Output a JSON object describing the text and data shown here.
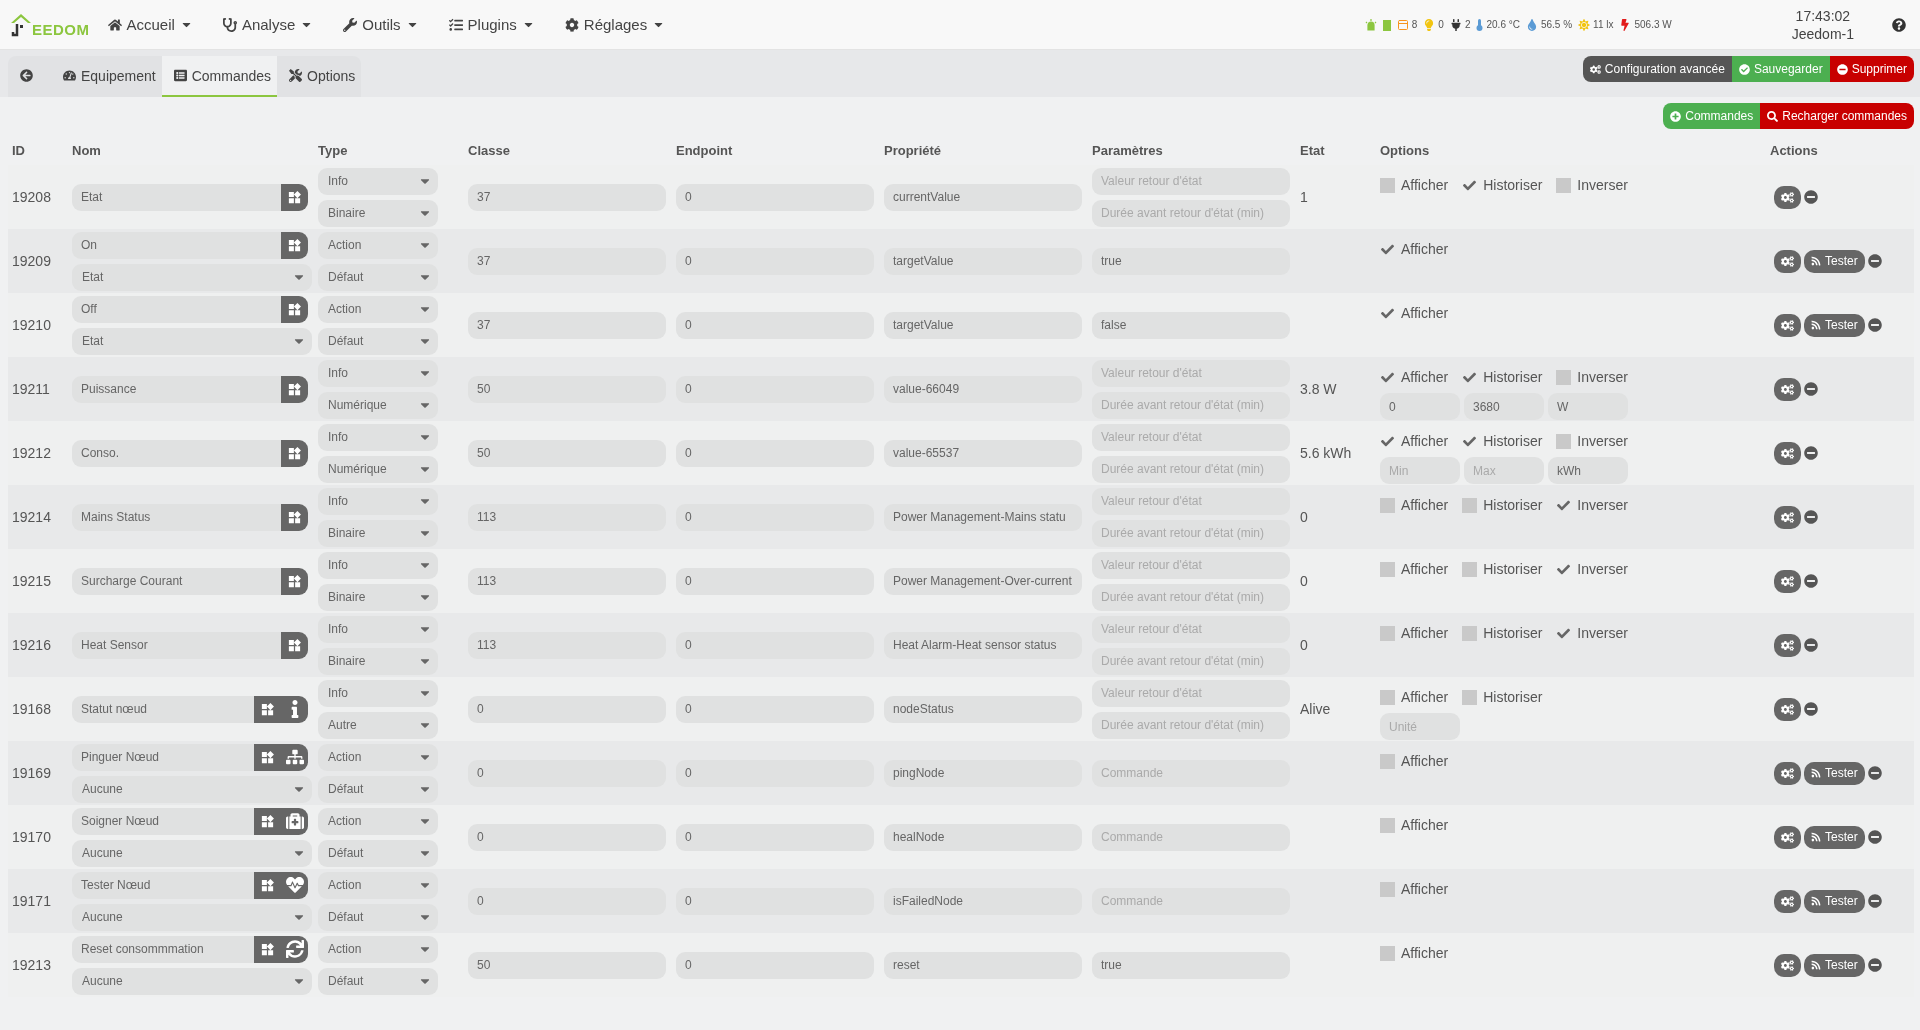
{
  "navbar": {
    "logo": "EEDOM",
    "menus": [
      {
        "kind": "home",
        "label": "Accueil"
      },
      {
        "kind": "stethoscope",
        "label": "Analyse"
      },
      {
        "kind": "wrench",
        "label": "Outils"
      },
      {
        "kind": "tasks",
        "label": "Plugins"
      },
      {
        "kind": "cog",
        "label": "Réglages"
      }
    ],
    "status": [
      {
        "kind": "siren",
        "color": "#8cc63f"
      },
      {
        "kind": "battery",
        "color": "#8cc63f"
      },
      {
        "kind": "window",
        "color": "#f7941d",
        "text": "8"
      },
      {
        "kind": "bulb",
        "color": "#f2c511",
        "text": "0"
      },
      {
        "kind": "plug",
        "color": "#333333",
        "text": "2"
      },
      {
        "kind": "thermometer",
        "color": "#5b9bd5",
        "text": "20.6 °C"
      },
      {
        "kind": "drop",
        "color": "#5b9bd5",
        "text": "56.5 %"
      },
      {
        "kind": "sun",
        "color": "#f2c511",
        "text": "11 lx"
      },
      {
        "kind": "bolt",
        "color": "#e21b1b",
        "text": "506.3 W"
      }
    ],
    "clock": "17:43:02",
    "host": "Jeedom-1"
  },
  "tabs": [
    {
      "kind": "back",
      "selected": false
    },
    {
      "kind": "gauge",
      "label": "Equipement",
      "selected": false
    },
    {
      "kind": "list",
      "label": "Commandes",
      "selected": true
    },
    {
      "kind": "tools",
      "label": "Options",
      "selected": false
    }
  ],
  "top_buttons": [
    {
      "kind": "advanced",
      "label": "Configuration avancée"
    },
    {
      "kind": "save",
      "label": "Sauvegarder"
    },
    {
      "kind": "delete",
      "label": "Supprimer"
    }
  ],
  "command_buttons": [
    {
      "kind": "add",
      "label": "Commandes"
    },
    {
      "kind": "reload",
      "label": "Recharger commandes"
    }
  ],
  "table": {
    "columns": [
      "ID",
      "Nom",
      "Type",
      "Classe",
      "Endpoint",
      "Propriété",
      "Paramètres",
      "Etat",
      "Options",
      "Actions"
    ],
    "rows": [
      {
        "id": "19208",
        "name": "Etat",
        "name_buttons": [
          {
            "kind": "widget"
          }
        ],
        "type": "Info",
        "subtype": "Binaire",
        "classe": "37",
        "endpoint": "0",
        "propriete": "currentValue",
        "params": [
          {
            "placeholder": "Valeur retour d'état"
          },
          {
            "placeholder": "Durée avant retour d'état (min)"
          }
        ],
        "etat": "1",
        "options": [
          {
            "label": "Afficher",
            "checked": false
          },
          {
            "label": "Historiser",
            "checked": true
          },
          {
            "label": "Inverser",
            "checked": false
          }
        ],
        "actions": [
          {
            "kind": "settings"
          },
          {
            "kind": "remove"
          }
        ]
      },
      {
        "id": "19209",
        "name": "On",
        "name_buttons": [
          {
            "kind": "widget"
          }
        ],
        "value_select": "Etat",
        "type": "Action",
        "subtype": "Défaut",
        "classe": "37",
        "endpoint": "0",
        "propriete": "targetValue",
        "params": [
          {
            "value": "true"
          }
        ],
        "options": [
          {
            "label": "Afficher",
            "checked": true
          }
        ],
        "actions": [
          {
            "kind": "settings"
          },
          {
            "kind": "test",
            "label": "Tester"
          },
          {
            "kind": "remove"
          }
        ]
      },
      {
        "id": "19210",
        "name": "Off",
        "name_buttons": [
          {
            "kind": "widget"
          }
        ],
        "value_select": "Etat",
        "type": "Action",
        "subtype": "Défaut",
        "classe": "37",
        "endpoint": "0",
        "propriete": "targetValue",
        "params": [
          {
            "value": "false"
          }
        ],
        "options": [
          {
            "label": "Afficher",
            "checked": true
          }
        ],
        "actions": [
          {
            "kind": "settings"
          },
          {
            "kind": "test",
            "label": "Tester"
          },
          {
            "kind": "remove"
          }
        ]
      },
      {
        "id": "19211",
        "name": "Puissance",
        "name_buttons": [
          {
            "kind": "widget"
          }
        ],
        "type": "Info",
        "subtype": "Numérique",
        "classe": "50",
        "endpoint": "0",
        "propriete": "value-66049",
        "params": [
          {
            "placeholder": "Valeur retour d'état"
          },
          {
            "placeholder": "Durée avant retour d'état (min)"
          }
        ],
        "etat": "3.8 W",
        "options": [
          {
            "label": "Afficher",
            "checked": true
          },
          {
            "label": "Historiser",
            "checked": true
          },
          {
            "label": "Inverser",
            "checked": false
          }
        ],
        "option_fields": [
          {
            "value": "0"
          },
          {
            "value": "3680"
          },
          {
            "value": "W"
          }
        ],
        "actions": [
          {
            "kind": "settings"
          },
          {
            "kind": "remove"
          }
        ]
      },
      {
        "id": "19212",
        "name": "Conso.",
        "name_buttons": [
          {
            "kind": "widget"
          }
        ],
        "type": "Info",
        "subtype": "Numérique",
        "classe": "50",
        "endpoint": "0",
        "propriete": "value-65537",
        "params": [
          {
            "placeholder": "Valeur retour d'état"
          },
          {
            "placeholder": "Durée avant retour d'état (min)"
          }
        ],
        "etat": "5.6 kWh",
        "options": [
          {
            "label": "Afficher",
            "checked": true
          },
          {
            "label": "Historiser",
            "checked": true
          },
          {
            "label": "Inverser",
            "checked": false
          }
        ],
        "option_fields": [
          {
            "placeholder": "Min"
          },
          {
            "placeholder": "Max"
          },
          {
            "value": "kWh"
          }
        ],
        "actions": [
          {
            "kind": "settings"
          },
          {
            "kind": "remove"
          }
        ]
      },
      {
        "id": "19214",
        "name": "Mains Status",
        "name_buttons": [
          {
            "kind": "widget"
          }
        ],
        "type": "Info",
        "subtype": "Binaire",
        "classe": "113",
        "endpoint": "0",
        "propriete": "Power Management-Mains statu",
        "params": [
          {
            "placeholder": "Valeur retour d'état"
          },
          {
            "placeholder": "Durée avant retour d'état (min)"
          }
        ],
        "etat": "0",
        "options": [
          {
            "label": "Afficher",
            "checked": false
          },
          {
            "label": "Historiser",
            "checked": false
          },
          {
            "label": "Inverser",
            "checked": true
          }
        ],
        "actions": [
          {
            "kind": "settings"
          },
          {
            "kind": "remove"
          }
        ]
      },
      {
        "id": "19215",
        "name": "Surcharge Courant",
        "name_buttons": [
          {
            "kind": "widget"
          }
        ],
        "type": "Info",
        "subtype": "Binaire",
        "classe": "113",
        "endpoint": "0",
        "propriete": "Power Management-Over-current",
        "params": [
          {
            "placeholder": "Valeur retour d'état"
          },
          {
            "placeholder": "Durée avant retour d'état (min)"
          }
        ],
        "etat": "0",
        "options": [
          {
            "label": "Afficher",
            "checked": false
          },
          {
            "label": "Historiser",
            "checked": false
          },
          {
            "label": "Inverser",
            "checked": true
          }
        ],
        "actions": [
          {
            "kind": "settings"
          },
          {
            "kind": "remove"
          }
        ]
      },
      {
        "id": "19216",
        "name": "Heat Sensor",
        "name_buttons": [
          {
            "kind": "widget"
          }
        ],
        "type": "Info",
        "subtype": "Binaire",
        "classe": "113",
        "endpoint": "0",
        "propriete": "Heat Alarm-Heat sensor status",
        "params": [
          {
            "placeholder": "Valeur retour d'état"
          },
          {
            "placeholder": "Durée avant retour d'état (min)"
          }
        ],
        "etat": "0",
        "options": [
          {
            "label": "Afficher",
            "checked": false
          },
          {
            "label": "Historiser",
            "checked": false
          },
          {
            "label": "Inverser",
            "checked": true
          }
        ],
        "actions": [
          {
            "kind": "settings"
          },
          {
            "kind": "remove"
          }
        ]
      },
      {
        "id": "19168",
        "name": "Statut nœud",
        "name_buttons": [
          {
            "kind": "widget"
          },
          {
            "kind": "info"
          }
        ],
        "type": "Info",
        "subtype": "Autre",
        "classe": "0",
        "endpoint": "0",
        "propriete": "nodeStatus",
        "params": [
          {
            "placeholder": "Valeur retour d'état"
          },
          {
            "placeholder": "Durée avant retour d'état (min)"
          }
        ],
        "etat": "Alive",
        "options": [
          {
            "label": "Afficher",
            "checked": false
          },
          {
            "label": "Historiser",
            "checked": false
          }
        ],
        "option_fields": [
          {
            "placeholder": "Unité"
          }
        ],
        "actions": [
          {
            "kind": "settings"
          },
          {
            "kind": "remove"
          }
        ]
      },
      {
        "id": "19169",
        "name": "Pinguer Nœud",
        "name_buttons": [
          {
            "kind": "widget"
          },
          {
            "kind": "sitemap"
          }
        ],
        "value_select": "Aucune",
        "type": "Action",
        "subtype": "Défaut",
        "classe": "0",
        "endpoint": "0",
        "propriete": "pingNode",
        "params": [
          {
            "placeholder": "Commande"
          }
        ],
        "options": [
          {
            "label": "Afficher",
            "checked": false
          }
        ],
        "actions": [
          {
            "kind": "settings"
          },
          {
            "kind": "test",
            "label": "Tester"
          },
          {
            "kind": "remove"
          }
        ]
      },
      {
        "id": "19170",
        "name": "Soigner Nœud",
        "name_buttons": [
          {
            "kind": "widget"
          },
          {
            "kind": "medkit"
          }
        ],
        "value_select": "Aucune",
        "type": "Action",
        "subtype": "Défaut",
        "classe": "0",
        "endpoint": "0",
        "propriete": "healNode",
        "params": [
          {
            "placeholder": "Commande"
          }
        ],
        "options": [
          {
            "label": "Afficher",
            "checked": false
          }
        ],
        "actions": [
          {
            "kind": "settings"
          },
          {
            "kind": "test",
            "label": "Tester"
          },
          {
            "kind": "remove"
          }
        ]
      },
      {
        "id": "19171",
        "name": "Tester Nœud",
        "name_buttons": [
          {
            "kind": "widget"
          },
          {
            "kind": "heartbeat"
          }
        ],
        "value_select": "Aucune",
        "type": "Action",
        "subtype": "Défaut",
        "classe": "0",
        "endpoint": "0",
        "propriete": "isFailedNode",
        "params": [
          {
            "placeholder": "Commande"
          }
        ],
        "options": [
          {
            "label": "Afficher",
            "checked": false
          }
        ],
        "actions": [
          {
            "kind": "settings"
          },
          {
            "kind": "test",
            "label": "Tester"
          },
          {
            "kind": "remove"
          }
        ]
      },
      {
        "id": "19213",
        "name": "Reset consommmation",
        "name_buttons": [
          {
            "kind": "widget"
          },
          {
            "kind": "refresh"
          }
        ],
        "value_select": "Aucune",
        "type": "Action",
        "subtype": "Défaut",
        "classe": "50",
        "endpoint": "0",
        "propriete": "reset",
        "params": [
          {
            "value": "true"
          }
        ],
        "options": [
          {
            "label": "Afficher",
            "checked": false
          }
        ],
        "actions": [
          {
            "kind": "settings"
          },
          {
            "kind": "test",
            "label": "Tester"
          },
          {
            "kind": "remove"
          }
        ]
      }
    ]
  }
}
